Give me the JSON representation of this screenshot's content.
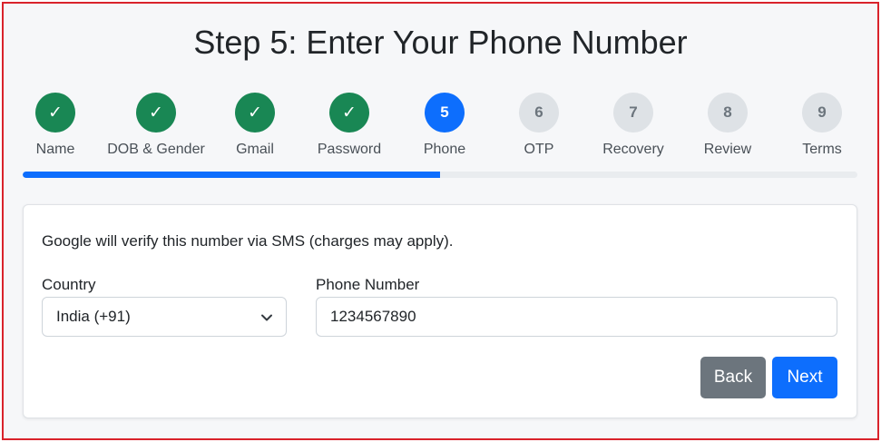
{
  "page": {
    "title": "Step 5: Enter Your Phone Number"
  },
  "colors": {
    "done": "#198754",
    "active": "#0d6efd",
    "todo": "#dee2e6",
    "frame_border": "#d9232b"
  },
  "steps": [
    {
      "number": "1",
      "label": "Name",
      "state": "done",
      "icon": "check-icon",
      "glyph": "✓"
    },
    {
      "number": "2",
      "label": "DOB & Gender",
      "state": "done",
      "icon": "check-icon",
      "glyph": "✓"
    },
    {
      "number": "3",
      "label": "Gmail",
      "state": "done",
      "icon": "check-icon",
      "glyph": "✓"
    },
    {
      "number": "4",
      "label": "Password",
      "state": "done",
      "icon": "check-icon",
      "glyph": "✓"
    },
    {
      "number": "5",
      "label": "Phone",
      "state": "active",
      "glyph": "5"
    },
    {
      "number": "6",
      "label": "OTP",
      "state": "todo",
      "glyph": "6"
    },
    {
      "number": "7",
      "label": "Recovery",
      "state": "todo",
      "glyph": "7"
    },
    {
      "number": "8",
      "label": "Review",
      "state": "todo",
      "glyph": "8"
    },
    {
      "number": "9",
      "label": "Terms",
      "state": "todo",
      "glyph": "9"
    }
  ],
  "progress": {
    "fraction": 0.5
  },
  "form": {
    "notice": "Google will verify this number via SMS (charges may apply).",
    "country_label": "Country",
    "country_value": "India (+91)",
    "phone_label": "Phone Number",
    "phone_value": "1234567890"
  },
  "buttons": {
    "back": "Back",
    "next": "Next"
  }
}
